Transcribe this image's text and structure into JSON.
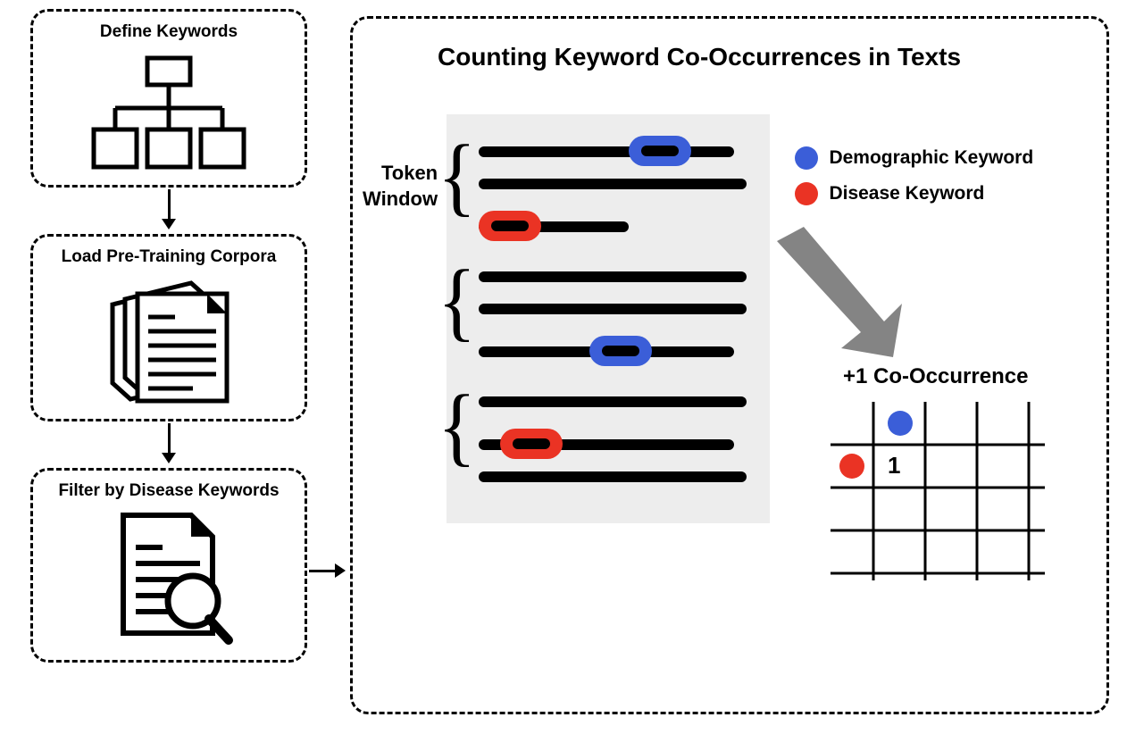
{
  "steps": {
    "define": "Define Keywords",
    "load": "Load Pre-Training Corpora",
    "filter": "Filter by Disease Keywords"
  },
  "main": {
    "title": "Counting Keyword Co-Occurrences in Texts",
    "token_window": "Token\nWindow",
    "legend": {
      "demographic": "Demographic Keyword",
      "disease": "Disease Keyword"
    },
    "cooccurrence": "+1 Co-Occurrence",
    "grid_value": "1"
  },
  "colors": {
    "blue": "#3b5ed8",
    "red": "#ea3324"
  }
}
